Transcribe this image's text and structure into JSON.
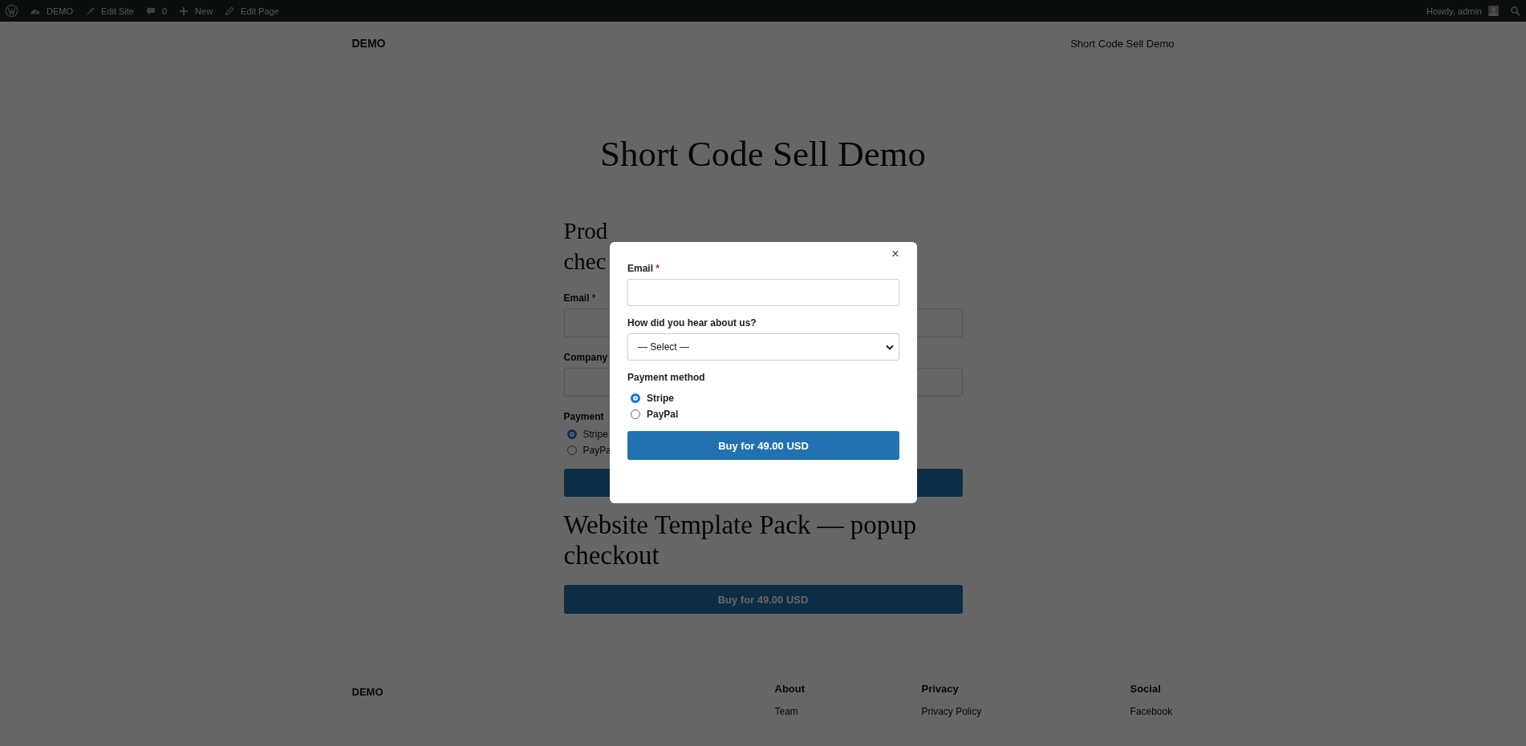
{
  "admin_bar": {
    "items": [
      {
        "kind": "wp-logo"
      },
      {
        "kind": "site",
        "label": "DEMO"
      },
      {
        "kind": "edit-site",
        "label": "Edit Site"
      },
      {
        "kind": "comments",
        "label": "0"
      },
      {
        "kind": "new",
        "label": "New"
      },
      {
        "kind": "edit-page",
        "label": "Edit Page"
      }
    ],
    "greeting": "Howdy, admin"
  },
  "header": {
    "site_title": "DEMO",
    "nav_link": "Short Code Sell Demo"
  },
  "page_title": "Short Code Sell Demo",
  "inline_product": {
    "heading_lines": [
      "Prod",
      "chec"
    ],
    "email_label": "Email",
    "required_mark": "*",
    "company_label": "Company",
    "payment_label": "Payment",
    "options": [
      {
        "label": "Stripe",
        "selected": true
      },
      {
        "label": "PayPa",
        "selected": false
      }
    ]
  },
  "popup_product": {
    "heading": "Website Template Pack — popup checkout",
    "button": "Buy for 49.00 USD"
  },
  "footer": {
    "site_title": "DEMO",
    "columns": [
      {
        "heading": "About",
        "link": "Team"
      },
      {
        "heading": "Privacy",
        "link": "Privacy Policy"
      },
      {
        "heading": "Social",
        "link": "Facebook"
      }
    ]
  },
  "modal": {
    "close": "×",
    "email_label": "Email",
    "required_mark": "*",
    "question_label": "How did you hear about us?",
    "select_value": "— Select —",
    "payment_label": "Payment method",
    "options": [
      {
        "label": "Stripe",
        "selected": true
      },
      {
        "label": "PayPal",
        "selected": false
      }
    ],
    "button": "Buy for 49.00 USD"
  }
}
